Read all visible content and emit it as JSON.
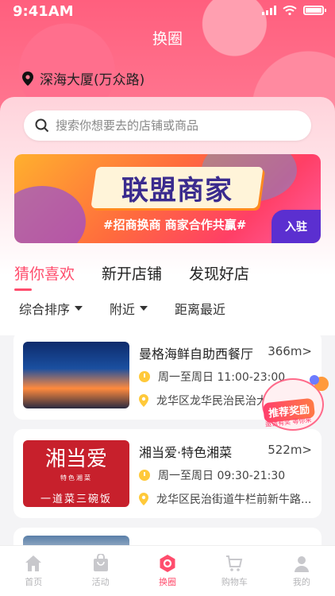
{
  "status_bar": {
    "time": "9:41AM"
  },
  "header": {
    "title": "换圈"
  },
  "location": {
    "text": "深海大厦(万众路)"
  },
  "search": {
    "placeholder": "搜索你想要去的店铺或商品"
  },
  "banner": {
    "headline": "联盟商家",
    "tagline": "#招商换商 商家合作共赢#",
    "join_label": "入驻"
  },
  "tabs": [
    {
      "label": "猜你喜欢",
      "active": true
    },
    {
      "label": "新开店铺",
      "active": false
    },
    {
      "label": "发现好店",
      "active": false
    }
  ],
  "filters": [
    {
      "label": "综合排序",
      "has_caret": true
    },
    {
      "label": "附近",
      "has_caret": true
    },
    {
      "label": "距离最近",
      "has_caret": false
    }
  ],
  "stores": [
    {
      "name": "曼格海鲜自助西餐厅",
      "distance": "366m>",
      "hours": "周一至周日 11:00-23:00",
      "address": "龙华区龙华民治民治大"
    },
    {
      "name": "湘当爱·特色湘菜",
      "distance": "522m>",
      "hours": "周一至周日 09:30-21:30",
      "address": "龙华区民治街道牛栏前新牛路...",
      "logo_text": "湘当爱",
      "logo_sub": "特色湘菜",
      "logo_slogan": "一道菜三碗饭"
    }
  ],
  "promo": {
    "label": "推荐奖励",
    "sub": "邀请有奖 等你来"
  },
  "tabbar": [
    {
      "label": "首页",
      "icon": "home-icon",
      "active": false
    },
    {
      "label": "活动",
      "icon": "bag-icon",
      "active": false
    },
    {
      "label": "换圈",
      "icon": "hexagon-icon",
      "active": true
    },
    {
      "label": "购物车",
      "icon": "cart-icon",
      "active": false
    },
    {
      "label": "我的",
      "icon": "user-icon",
      "active": false
    }
  ],
  "colors": {
    "accent": "#ff4d6d",
    "icon_yellow": "#ffc93a"
  }
}
